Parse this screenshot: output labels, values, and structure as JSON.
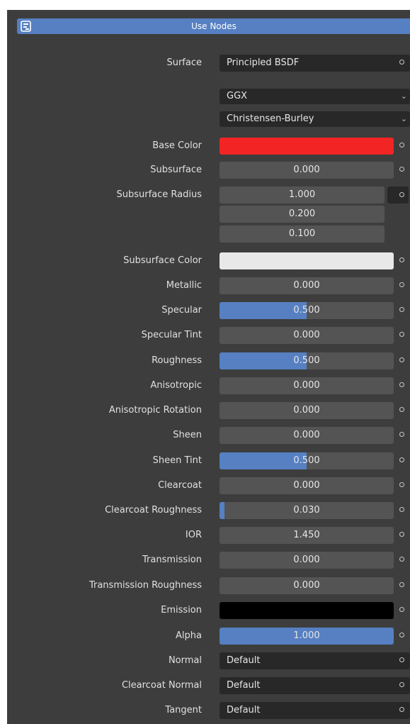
{
  "use_nodes": {
    "label": "Use Nodes"
  },
  "surface": {
    "label": "Surface",
    "value": "Principled BSDF"
  },
  "distribution": {
    "value": "GGX"
  },
  "subsurface_method": {
    "value": "Christensen-Burley"
  },
  "base_color": {
    "label": "Base Color",
    "color": "#f22424"
  },
  "subsurface": {
    "label": "Subsurface",
    "value": "0.000",
    "fraction": 0
  },
  "subsurface_radius": {
    "label": "Subsurface Radius",
    "values": [
      "1.000",
      "0.200",
      "0.100"
    ]
  },
  "subsurface_color": {
    "label": "Subsurface Color",
    "color": "#e8e8e8"
  },
  "metallic": {
    "label": "Metallic",
    "value": "0.000",
    "fraction": 0
  },
  "specular": {
    "label": "Specular",
    "value": "0.500",
    "fraction": 0.5
  },
  "specular_tint": {
    "label": "Specular Tint",
    "value": "0.000",
    "fraction": 0
  },
  "roughness": {
    "label": "Roughness",
    "value": "0.500",
    "fraction": 0.5
  },
  "anisotropic": {
    "label": "Anisotropic",
    "value": "0.000",
    "fraction": 0
  },
  "anisotropic_rotation": {
    "label": "Anisotropic Rotation",
    "value": "0.000",
    "fraction": 0
  },
  "sheen": {
    "label": "Sheen",
    "value": "0.000",
    "fraction": 0
  },
  "sheen_tint": {
    "label": "Sheen Tint",
    "value": "0.500",
    "fraction": 0.5
  },
  "clearcoat": {
    "label": "Clearcoat",
    "value": "0.000",
    "fraction": 0
  },
  "clearcoat_roughness": {
    "label": "Clearcoat Roughness",
    "value": "0.030",
    "fraction": 0.03
  },
  "ior": {
    "label": "IOR",
    "value": "1.450"
  },
  "transmission": {
    "label": "Transmission",
    "value": "0.000",
    "fraction": 0
  },
  "transmission_roughness": {
    "label": "Transmission Roughness",
    "value": "0.000",
    "fraction": 0
  },
  "emission": {
    "label": "Emission",
    "color": "#000000"
  },
  "alpha": {
    "label": "Alpha",
    "value": "1.000",
    "fraction": 1
  },
  "normal": {
    "label": "Normal",
    "value": "Default"
  },
  "clearcoat_normal": {
    "label": "Clearcoat Normal",
    "value": "Default"
  },
  "tangent": {
    "label": "Tangent",
    "value": "Default"
  },
  "colors": {
    "accent": "#5680c2",
    "panel": "#3d3d3d",
    "field": "#545454",
    "menu": "#282828"
  }
}
